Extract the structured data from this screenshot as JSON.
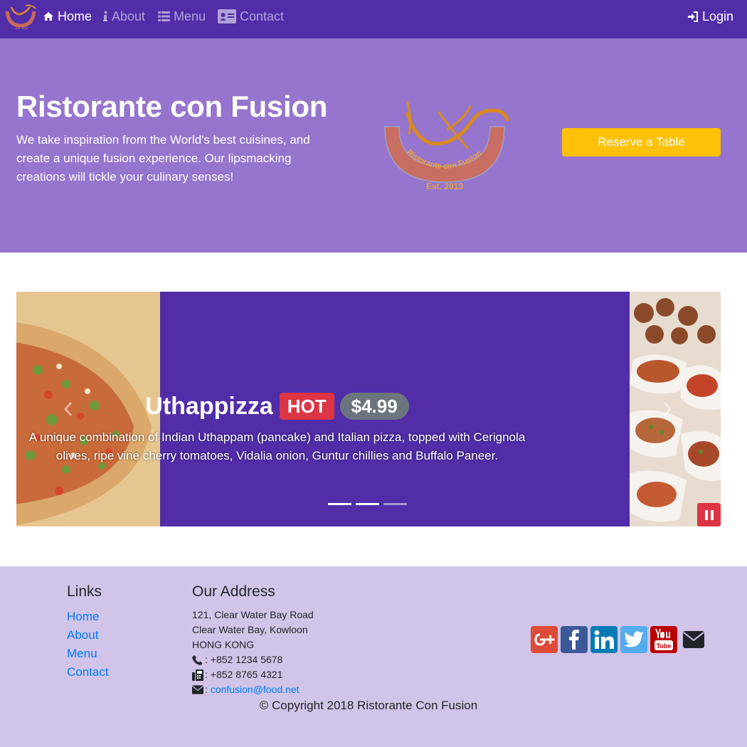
{
  "navbar": {
    "logo_icon": "restaurant-logo",
    "items": [
      {
        "label": "Home",
        "icon": "home-icon",
        "active": true
      },
      {
        "label": "About",
        "icon": "info-icon",
        "active": false
      },
      {
        "label": "Menu",
        "icon": "list-icon",
        "active": false
      },
      {
        "label": "Contact",
        "icon": "address-card-icon",
        "active": false
      }
    ],
    "login_label": "Login",
    "login_icon": "sign-in-icon"
  },
  "jumbotron": {
    "title": "Ristorante con Fusion",
    "text": "We take inspiration from the World's best cuisines, and create a unique fusion experience. Our lipsmacking creations will tickle your culinary senses!",
    "logo": {
      "arc_text": "Ristorante con Fusion",
      "est_text": "Est. 2013"
    },
    "reserve_label": "Reserve a Table"
  },
  "carousel": {
    "dish_name": "Uthappizza",
    "badge": "HOT",
    "price": "$4.99",
    "description": "A unique combination of Indian Uthappam (pancake) and Italian pizza, topped with Cerignola olives, ripe vine cherry tomatoes, Vidalia onion, Guntur chillies and Buffalo Paneer.",
    "indicator_count": 3,
    "active_indicator": 0,
    "pause_icon": "pause-icon"
  },
  "footer": {
    "links_heading": "Links",
    "links": [
      "Home",
      "About",
      "Menu",
      "Contact"
    ],
    "address_heading": "Our Address",
    "address_lines": [
      "121, Clear Water Bay Road",
      "Clear Water Bay, Kowloon",
      "HONG KONG"
    ],
    "phone": ": +852 1234 5678",
    "fax": ": +852 8765 4321",
    "email_prefix": ": ",
    "email": "confusion@food.net",
    "social": [
      "google-plus-icon",
      "facebook-icon",
      "linkedin-icon",
      "twitter-icon",
      "youtube-icon",
      "envelope-icon"
    ],
    "copyright": "© Copyright 2018 Ristorante Con Fusion"
  },
  "colors": {
    "navbar": "#512da8",
    "jumbotron": "#9575cd",
    "footer": "#d1c4e9",
    "reserve_button": "#ffc107",
    "badge_hot": "#dc3545",
    "badge_price": "#6c757d",
    "link": "#007bff"
  }
}
